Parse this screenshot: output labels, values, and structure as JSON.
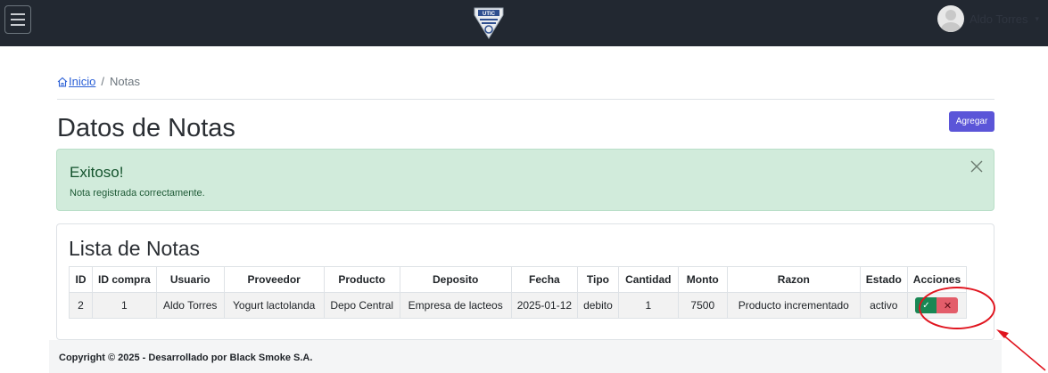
{
  "header": {
    "user_name": "Aldo Torres",
    "logo_text": "UTIC"
  },
  "breadcrumb": {
    "home_label": "Inicio",
    "separator": "/",
    "current": "Notas"
  },
  "page": {
    "title": "Datos de Notas",
    "add_label": "Agregar"
  },
  "alert": {
    "title": "Exitoso!",
    "message": "Nota registrada correctamente.",
    "close_symbol": "✕"
  },
  "table": {
    "title": "Lista de Notas",
    "columns": [
      "ID",
      "ID compra",
      "Usuario",
      "Proveedor",
      "Producto",
      "Deposito",
      "Fecha",
      "Tipo",
      "Cantidad",
      "Monto",
      "Razon",
      "Estado",
      "Acciones"
    ],
    "rows": [
      [
        "2",
        "1",
        "Aldo Torres",
        "Yogurt lactolanda",
        "Depo Central",
        "Empresa de lacteos",
        "2025-01-12",
        "debito",
        "1",
        "7500",
        "Producto incrementado",
        "activo"
      ]
    ],
    "action_ok_symbol": "✓",
    "action_delete_symbol": "✕"
  },
  "footer": {
    "text": "Copyright © 2025 - Desarrollado por Black Smoke S.A."
  },
  "colors": {
    "topbar": "#222831",
    "primary": "#5b55d8",
    "success_bg": "#d1ebdb",
    "success_btn": "#198754",
    "danger_btn": "#e35d6a",
    "annotation": "#e0141e"
  }
}
